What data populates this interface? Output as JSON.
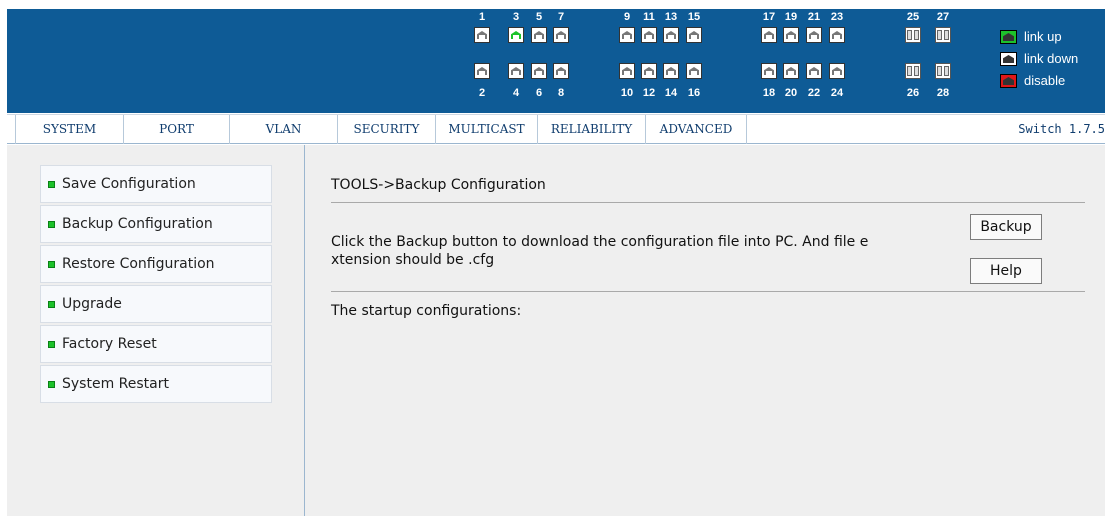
{
  "header": {
    "ports_top_numbers": [
      "1",
      "3",
      "5",
      "7",
      "9",
      "11",
      "13",
      "15",
      "17",
      "19",
      "21",
      "23",
      "25",
      "27"
    ],
    "ports_bottom_numbers": [
      "2",
      "4",
      "6",
      "8",
      "10",
      "12",
      "14",
      "16",
      "18",
      "20",
      "22",
      "24",
      "26",
      "28"
    ],
    "ports_up": [
      "3"
    ],
    "legend": [
      {
        "label": "link up",
        "color": "#1dc22a"
      },
      {
        "label": "link down",
        "color": "#ffffff"
      },
      {
        "label": "disable",
        "color": "#e01717"
      }
    ],
    "bar_color": "#0e5b96"
  },
  "nav": {
    "items": [
      "SYSTEM",
      "PORT",
      "VLAN",
      "SECURITY",
      "MULTICAST",
      "RELIABILITY",
      "ADVANCED"
    ],
    "version": "Switch 1.7.5"
  },
  "sidebar": {
    "items": [
      "Save Configuration",
      "Backup Configuration",
      "Restore Configuration",
      "Upgrade",
      "Factory Reset",
      "System Restart"
    ]
  },
  "main": {
    "title": "TOOLS->Backup Configuration",
    "description": "Click the Backup button to download the configuration file into PC. And file e xtension should be .cfg",
    "backup_button": "Backup",
    "help_button": "Help",
    "startup_label": "The startup configurations:"
  }
}
